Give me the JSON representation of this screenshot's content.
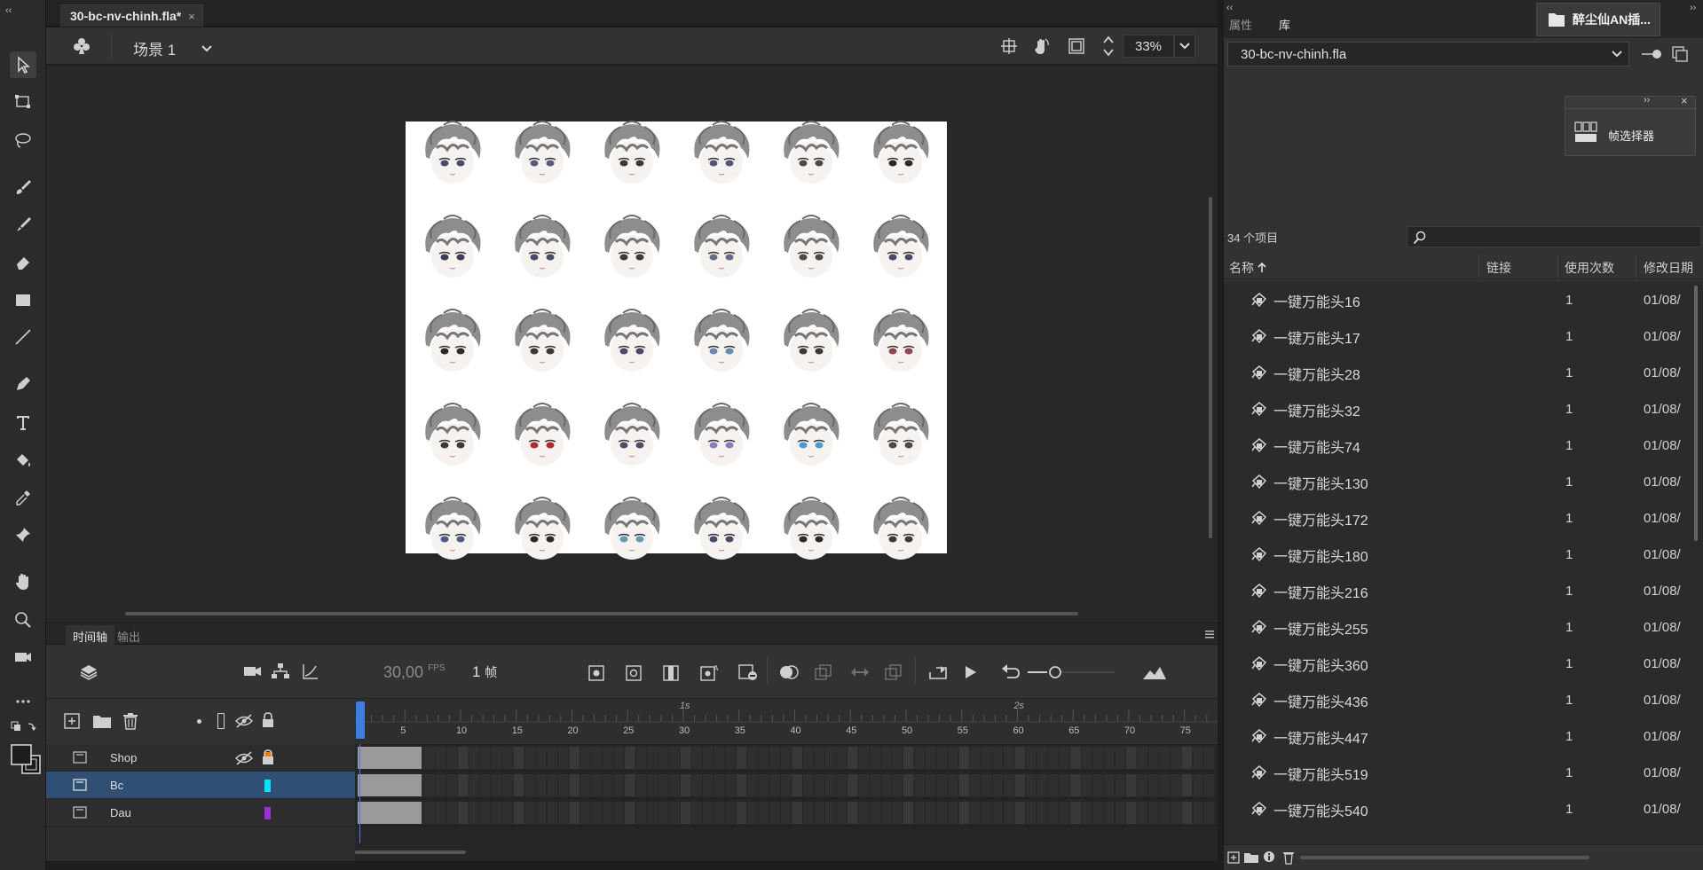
{
  "document": {
    "tab_title": "30-bc-nv-chinh.fla*"
  },
  "editbar": {
    "scene_label": "场景 1",
    "zoom": "33%"
  },
  "timeline": {
    "tabs": [
      "时间轴",
      "输出"
    ],
    "fps": "30,00",
    "fps_unit": "FPS",
    "frame_number": "1",
    "frame_unit": "帧",
    "ruler_seconds": [
      "1s",
      "2s"
    ],
    "ruler_frames": [
      "5",
      "10",
      "15",
      "20",
      "25",
      "30",
      "35",
      "40",
      "45",
      "50",
      "55",
      "60",
      "65",
      "70",
      "75"
    ],
    "layers": [
      {
        "name": "Shop",
        "color": "#ff7a00",
        "selected": false
      },
      {
        "name": "Bc",
        "color": "#00e5ff",
        "selected": true
      },
      {
        "name": "Dau",
        "color": "#9b30d9",
        "selected": false
      }
    ]
  },
  "right_panel": {
    "tabs": [
      "属性",
      "库"
    ],
    "active_tab": "库",
    "plugin_button": "醉尘仙AN插...",
    "file_name": "30-bc-nv-chinh.fla",
    "frame_picker_label": "帧选择器",
    "item_count": "34 个项目",
    "columns": {
      "name": "名称",
      "link": "链接",
      "uses": "使用次数",
      "date": "修改日期"
    },
    "items": [
      {
        "name": "一键万能头16",
        "uses": "1",
        "date": "01/08/"
      },
      {
        "name": "一键万能头17",
        "uses": "1",
        "date": "01/08/"
      },
      {
        "name": "一键万能头28",
        "uses": "1",
        "date": "01/08/"
      },
      {
        "name": "一键万能头32",
        "uses": "1",
        "date": "01/08/"
      },
      {
        "name": "一键万能头74",
        "uses": "1",
        "date": "01/08/"
      },
      {
        "name": "一键万能头130",
        "uses": "1",
        "date": "01/08/"
      },
      {
        "name": "一键万能头172",
        "uses": "1",
        "date": "01/08/"
      },
      {
        "name": "一键万能头180",
        "uses": "1",
        "date": "01/08/"
      },
      {
        "name": "一键万能头216",
        "uses": "1",
        "date": "01/08/"
      },
      {
        "name": "一键万能头255",
        "uses": "1",
        "date": "01/08/"
      },
      {
        "name": "一键万能头360",
        "uses": "1",
        "date": "01/08/"
      },
      {
        "name": "一键万能头436",
        "uses": "1",
        "date": "01/08/"
      },
      {
        "name": "一键万能头447",
        "uses": "1",
        "date": "01/08/"
      },
      {
        "name": "一键万能头519",
        "uses": "1",
        "date": "01/08/"
      },
      {
        "name": "一键万能头540",
        "uses": "1",
        "date": "01/08/"
      }
    ]
  },
  "colors": {
    "selection": "#2f4f75",
    "playhead": "#3d7ee0"
  }
}
